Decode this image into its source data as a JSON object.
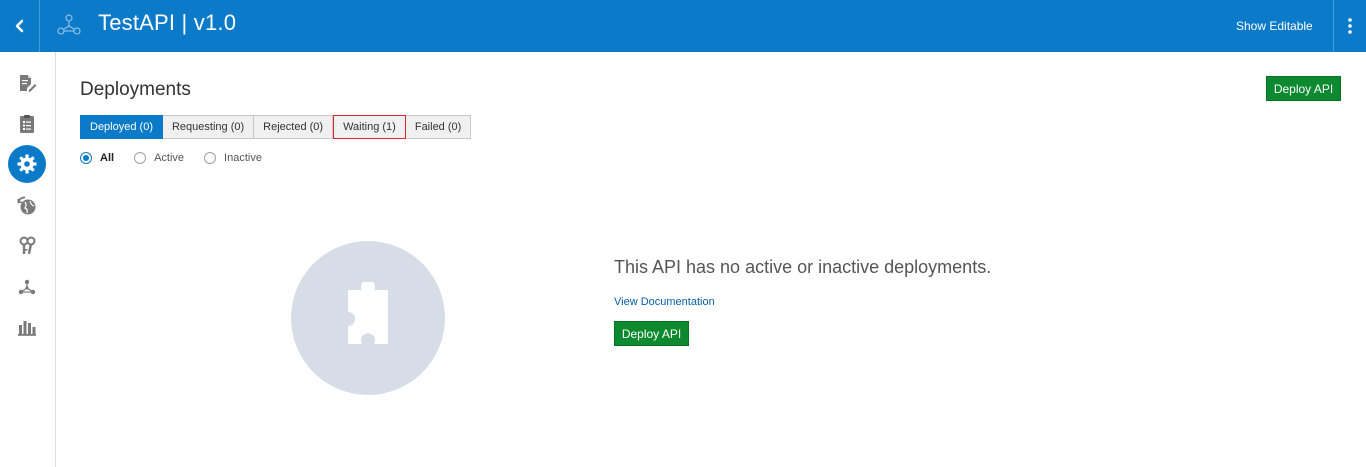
{
  "header": {
    "title": "TestAPI | v1.0",
    "show_editable_label": "Show Editable",
    "back_icon": "chevron-left-icon",
    "logo_icon": "api-network-icon",
    "menu_icon": "vertical-dots-icon",
    "color": "#0a7ac9"
  },
  "sidebar": {
    "items": [
      {
        "name": "edit-document-icon",
        "active": false
      },
      {
        "name": "list-document-icon",
        "active": false
      },
      {
        "name": "gear-icon",
        "active": true
      },
      {
        "name": "globe-refresh-icon",
        "active": false
      },
      {
        "name": "keys-icon",
        "active": false
      },
      {
        "name": "api-network-icon",
        "active": false
      },
      {
        "name": "bar-chart-icon",
        "active": false
      }
    ]
  },
  "main": {
    "title": "Deployments",
    "deploy_button_label": "Deploy API",
    "tabs": [
      {
        "label": "Deployed (0)",
        "active": true
      },
      {
        "label": "Requesting (0)",
        "active": false
      },
      {
        "label": "Rejected (0)",
        "active": false
      },
      {
        "label": "Waiting (1)",
        "active": false,
        "highlighted": true
      },
      {
        "label": "Failed (0)",
        "active": false
      }
    ],
    "filters": [
      {
        "label": "All",
        "checked": true
      },
      {
        "label": "Active",
        "checked": false
      },
      {
        "label": "Inactive",
        "checked": false
      }
    ],
    "empty_state": {
      "icon": "puzzle-piece-icon",
      "message": "This API has no active or inactive deployments.",
      "link_label": "View Documentation",
      "button_label": "Deploy API"
    },
    "accent_green": "#0d8a2f"
  }
}
